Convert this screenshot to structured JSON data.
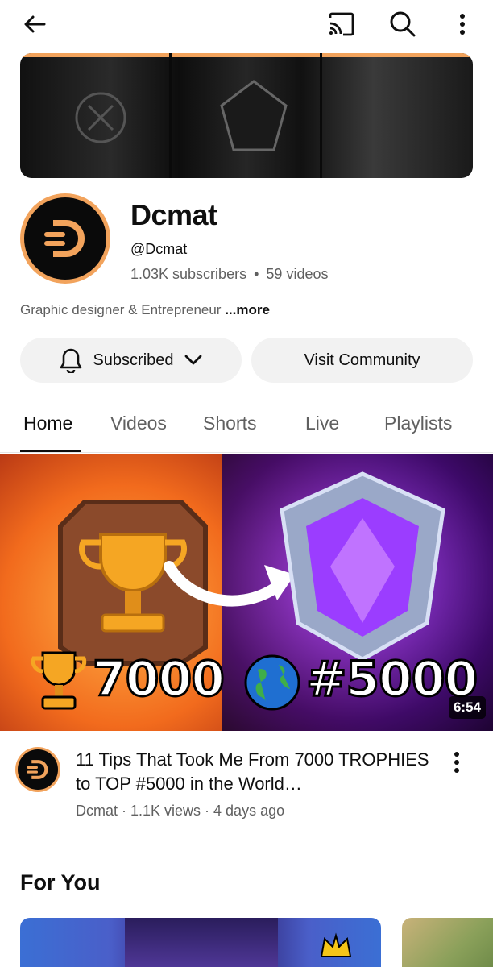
{
  "header": {
    "back_icon": "arrow-left-icon",
    "cast_icon": "cast-icon",
    "search_icon": "search-icon",
    "more_icon": "more-vert-icon"
  },
  "channel": {
    "name": "Dcmat",
    "handle": "@Dcmat",
    "subscribers": "1.03K subscribers",
    "separator": "•",
    "videos": "59 videos",
    "description": "Graphic designer & Entrepreneur ",
    "more_label": "...more"
  },
  "actions": {
    "subscribed_label": "Subscribed",
    "community_label": "Visit Community"
  },
  "tabs": [
    {
      "label": "Home",
      "active": true
    },
    {
      "label": "Videos",
      "active": false
    },
    {
      "label": "Shorts",
      "active": false
    },
    {
      "label": "Live",
      "active": false
    },
    {
      "label": "Playlists",
      "active": false
    }
  ],
  "featured_video": {
    "duration": "6:54",
    "title": "11 Tips That Took Me From 7000 TROPHIES to TOP #5000 in the World…",
    "meta": "Dcmat · 1.1K views · 4 days ago",
    "thumb_text_left": "7000",
    "thumb_text_right": "#5000"
  },
  "for_you": {
    "title": "For You"
  },
  "colors": {
    "accent": "#f2a35c",
    "text_primary": "#0f0f0f",
    "text_secondary": "#606060",
    "button_bg": "#f2f2f2"
  }
}
